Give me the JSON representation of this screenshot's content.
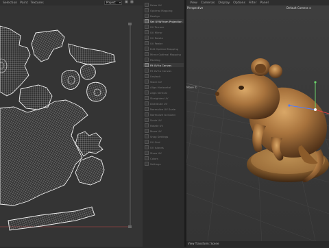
{
  "uv_editor": {
    "menu": [
      "Selection",
      "Paint",
      "Textures"
    ],
    "project_select": "Project",
    "icons": [
      "lock-icon",
      "image-icon"
    ]
  },
  "tools_panel": {
    "items": [
      {
        "label": "Relax UV",
        "highlighted": false
      },
      {
        "label": "Optimal Mapping",
        "highlighted": false
      },
      {
        "label": "Realign",
        "highlighted": false
      },
      {
        "label": "Set UVW from Projection",
        "highlighted": true,
        "badge": true
      },
      {
        "label": "UV Terrace",
        "highlighted": false
      },
      {
        "label": "UV Mirror",
        "highlighted": false
      },
      {
        "label": "UV Rotate",
        "highlighted": false
      },
      {
        "label": "UV Peeler",
        "highlighted": false
      },
      {
        "label": "Edit Optimal Mapping",
        "highlighted": false
      },
      {
        "label": "Mirror Optimal Mapping",
        "highlighted": false
      },
      {
        "label": "Packing",
        "highlighted": false
      },
      {
        "label": "Fit UV to Canvas",
        "highlighted": true,
        "badge": false
      },
      {
        "label": "Fit UV to Canvas",
        "highlighted": false
      },
      {
        "label": "Unstack",
        "highlighted": false
      },
      {
        "label": "Stack UV",
        "highlighted": false
      },
      {
        "label": "Align Horizontal",
        "highlighted": false
      },
      {
        "label": "Align Vertical",
        "highlighted": false
      },
      {
        "label": "Straighten UV",
        "highlighted": false
      },
      {
        "label": "Distribute UV",
        "highlighted": false
      },
      {
        "label": "Normalize UV Scale",
        "highlighted": false
      },
      {
        "label": "Normalize to Island",
        "highlighted": false
      },
      {
        "label": "Scale UV",
        "highlighted": false
      },
      {
        "label": "Rotate UV",
        "highlighted": false
      },
      {
        "label": "Move UV",
        "highlighted": false
      },
      {
        "label": "Snap Settings",
        "highlighted": false
      },
      {
        "label": "UV Grid",
        "highlighted": false
      },
      {
        "label": "UV Islands",
        "highlighted": false
      },
      {
        "label": "Show UV",
        "highlighted": false
      },
      {
        "label": "Colors",
        "highlighted": false
      },
      {
        "label": "Settings",
        "highlighted": false
      }
    ]
  },
  "viewport": {
    "menu": [
      "View",
      "Cameras",
      "Display",
      "Options",
      "Filter",
      "Panel"
    ],
    "projection": "Perspective",
    "camera": "Default Camera ⊙",
    "move_label": "Move ©",
    "status": "View Transform: Scene"
  },
  "colors": {
    "panel_bg": "#2e2e2e",
    "uv_canvas": "#343434",
    "viewport_bg": "#3a3a3a",
    "highlight_text": "#e6e6e6",
    "axis_x": "#e04343",
    "axis_y": "#6bd36b",
    "axis_z": "#4f7cff"
  }
}
